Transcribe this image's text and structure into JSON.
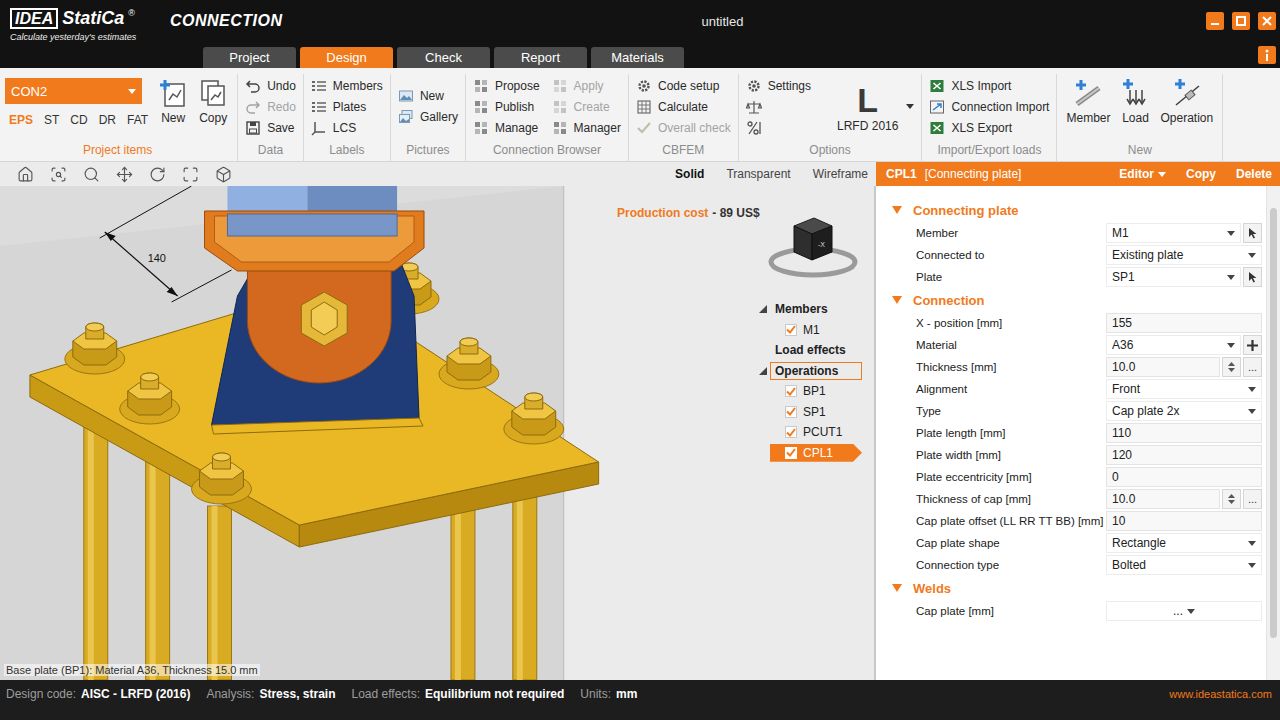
{
  "app": {
    "logo": "IDEA",
    "brand": "StatiCa",
    "mark": "®",
    "tagline": "Calculate yesterday's estimates",
    "module": "CONNECTION"
  },
  "window": {
    "title": "untitled"
  },
  "tabs": [
    {
      "label": "Project",
      "selected": false
    },
    {
      "label": "Design",
      "selected": true
    },
    {
      "label": "Check",
      "selected": false
    },
    {
      "label": "Report",
      "selected": false
    },
    {
      "label": "Materials",
      "selected": false
    }
  ],
  "ribbon": {
    "groups": [
      {
        "kind": "project",
        "label": "Project items",
        "highlight": true,
        "connection": "CON2",
        "codes": [
          {
            "label": "EPS",
            "selected": true
          },
          {
            "label": "ST",
            "selected": false
          },
          {
            "label": "CD",
            "selected": false
          },
          {
            "label": "DR",
            "selected": false
          },
          {
            "label": "FAT",
            "selected": false
          }
        ],
        "buttons": [
          {
            "label": "New"
          },
          {
            "label": "Copy"
          }
        ]
      },
      {
        "kind": "small",
        "label": "Data",
        "highlight": false,
        "columns": [
          [
            {
              "label": "Undo",
              "disabled": false
            },
            {
              "label": "Redo",
              "disabled": true
            },
            {
              "label": "Save",
              "disabled": false
            }
          ]
        ]
      },
      {
        "kind": "small",
        "label": "Labels",
        "highlight": false,
        "columns": [
          [
            {
              "label": "Members",
              "disabled": false
            },
            {
              "label": "Plates",
              "disabled": false
            },
            {
              "label": "LCS",
              "disabled": false
            }
          ]
        ]
      },
      {
        "kind": "small",
        "label": "Pictures",
        "highlight": false,
        "columns": [
          [
            {
              "label": "New",
              "disabled": false
            },
            {
              "label": "Gallery",
              "disabled": false
            }
          ]
        ]
      },
      {
        "kind": "small",
        "label": "Connection Browser",
        "highlight": false,
        "columns": [
          [
            {
              "label": "Propose",
              "disabled": false
            },
            {
              "label": "Publish",
              "disabled": false
            },
            {
              "label": "Manage",
              "disabled": false
            }
          ],
          [
            {
              "label": "Apply",
              "disabled": true
            },
            {
              "label": "Create",
              "disabled": true
            },
            {
              "label": "Manager",
              "disabled": false
            }
          ]
        ]
      },
      {
        "kind": "small",
        "label": "CBFEM",
        "highlight": false,
        "columns": [
          [
            {
              "label": "Code setup",
              "disabled": false
            },
            {
              "label": "Calculate",
              "disabled": false
            },
            {
              "label": "Overall check",
              "disabled": true
            }
          ]
        ]
      },
      {
        "kind": "options",
        "label": "Options",
        "highlight": false,
        "items": [
          {
            "label": "Settings",
            "disabled": false
          }
        ],
        "code_letter": "L",
        "code": "LRFD 2016"
      },
      {
        "kind": "small",
        "label": "Import/Export loads",
        "highlight": false,
        "columns": [
          [
            {
              "label": "XLS Import",
              "disabled": false
            },
            {
              "label": "Connection Import",
              "disabled": false
            },
            {
              "label": "XLS Export",
              "disabled": false
            }
          ]
        ]
      },
      {
        "kind": "large",
        "label": "New",
        "highlight": false,
        "buttons": [
          {
            "label": "Member"
          },
          {
            "label": "Load"
          },
          {
            "label": "Operation"
          }
        ]
      }
    ]
  },
  "viewport": {
    "view_modes": [
      {
        "label": "Solid",
        "selected": true
      },
      {
        "label": "Transparent",
        "selected": false
      },
      {
        "label": "Wireframe",
        "selected": false
      }
    ],
    "dimension": "140",
    "cost": {
      "label": "Production cost",
      "value": "- 89 US$"
    },
    "cube_label": "-X",
    "tree": [
      {
        "label": "Members",
        "kind": "group",
        "expanded": true,
        "focused": false
      },
      {
        "label": "M1",
        "kind": "item",
        "checked": true,
        "selected": false
      },
      {
        "label": "Load effects",
        "kind": "group",
        "focused": false
      },
      {
        "label": "Operations",
        "kind": "group",
        "expanded": true,
        "focused": true
      },
      {
        "label": "BP1",
        "kind": "item",
        "checked": true,
        "selected": false
      },
      {
        "label": "SP1",
        "kind": "item",
        "checked": true,
        "selected": false
      },
      {
        "label": "PCUT1",
        "kind": "item",
        "checked": true,
        "selected": false
      },
      {
        "label": "CPL1",
        "kind": "item",
        "checked": true,
        "selected": true
      }
    ],
    "hint": "Base plate (BP1): Material A36, Thickness 15.0 mm"
  },
  "panel": {
    "title": "CPL1",
    "subtitle": "[Connecting plate]",
    "actions": [
      {
        "label": "Editor",
        "dropdown": true
      },
      {
        "label": "Copy",
        "dropdown": false
      },
      {
        "label": "Delete",
        "dropdown": false
      }
    ],
    "sections": [
      {
        "title": "Connecting plate",
        "expanded": true,
        "rows": [
          {
            "label": "Member",
            "value": "M1",
            "kind": "pick"
          },
          {
            "label": "Connected to",
            "value": "Existing plate",
            "kind": "select"
          },
          {
            "label": "Plate",
            "value": "SP1",
            "kind": "pick"
          }
        ]
      },
      {
        "title": "Connection",
        "expanded": true,
        "rows": [
          {
            "label": "X - position [mm]",
            "value": "155",
            "kind": "text"
          },
          {
            "label": "Material",
            "value": "A36",
            "kind": "add"
          },
          {
            "label": "Thickness [mm]",
            "value": "10.0",
            "kind": "spin",
            "more": "..."
          },
          {
            "label": "Alignment",
            "value": "Front",
            "kind": "select"
          },
          {
            "label": "Type",
            "value": "Cap plate 2x",
            "kind": "select"
          },
          {
            "label": "Plate length [mm]",
            "value": "110",
            "kind": "text"
          },
          {
            "label": "Plate width [mm]",
            "value": "120",
            "kind": "text"
          },
          {
            "label": "Plate eccentricity [mm]",
            "value": "0",
            "kind": "text"
          },
          {
            "label": "Thickness of cap [mm]",
            "value": "10.0",
            "kind": "spin",
            "more": "..."
          },
          {
            "label": "Cap plate offset (LL RR TT BB) [mm]",
            "value": "10",
            "kind": "text"
          },
          {
            "label": "Cap plate shape",
            "value": "Rectangle",
            "kind": "select"
          },
          {
            "label": "Connection type",
            "value": "Bolted",
            "kind": "select"
          }
        ]
      },
      {
        "title": "Welds",
        "expanded": true,
        "rows": [
          {
            "label": "Cap plate [mm]",
            "value": "...",
            "kind": "dots"
          }
        ]
      }
    ]
  },
  "status_bar": {
    "items": [
      {
        "label": "Design code:",
        "value": "AISC - LRFD (2016)"
      },
      {
        "label": "Analysis:",
        "value": "Stress, strain"
      },
      {
        "label": "Load effects:",
        "value": "Equilibrium not required"
      },
      {
        "label": "Units:",
        "value": "mm"
      }
    ],
    "url": "www.ideastatica.com"
  }
}
